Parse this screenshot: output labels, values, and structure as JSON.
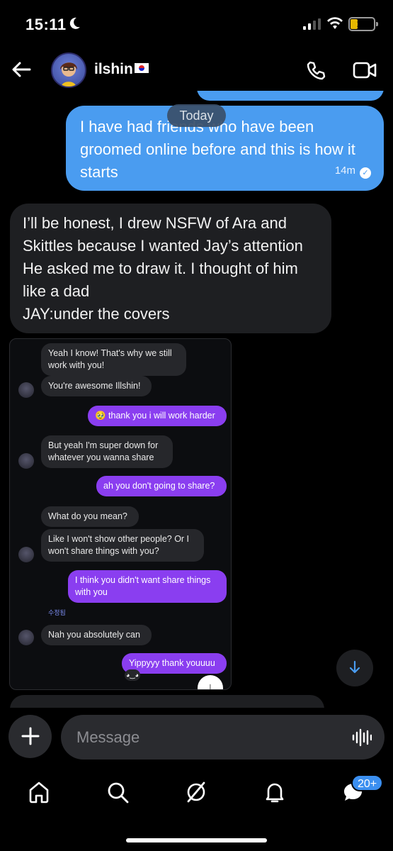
{
  "status_bar": {
    "time": "15:11",
    "battery": "10"
  },
  "header": {
    "name": "ilshin",
    "flag": "🇰🇷"
  },
  "chat": {
    "date_divider": "Today",
    "outgoing": {
      "text": "I have had friends who have been groomed online before and this is how it starts",
      "time": "14m"
    },
    "incoming": {
      "lines": [
        "I’ll be honest, I drew NSFW of Ara and",
        "Skittles because I wanted Jay’s attention",
        "He asked me to draw it. I thought of him",
        "like a dad",
        "JAY:under the covers"
      ]
    }
  },
  "embedded": {
    "messages": [
      {
        "text": "Yeah I know! That's why we still work with you!"
      },
      {
        "text": "You're awesome Illshin!"
      },
      {
        "text": "🥹 thank you i will work harder"
      },
      {
        "text": "But yeah I'm super down for whatever you wanna share"
      },
      {
        "text": "ah you don't going to share?"
      },
      {
        "text": "What do you mean?"
      },
      {
        "text": "Like I won't show other people? Or I won't share things with you?"
      },
      {
        "text": "I think you didn't want share things with you"
      },
      {
        "text": "Nah you absolutely can"
      },
      {
        "text": "Yippyyy thank youuuu"
      }
    ],
    "edited_label": "수정됨"
  },
  "composer": {
    "placeholder": "Message"
  },
  "nav": {
    "badge": "20+"
  },
  "colors": {
    "outgoing_bubble": "#4a9cf0",
    "incoming_bubble": "#1e1f22",
    "embedded_outgoing": "#8a3ef0",
    "background": "#000000"
  }
}
